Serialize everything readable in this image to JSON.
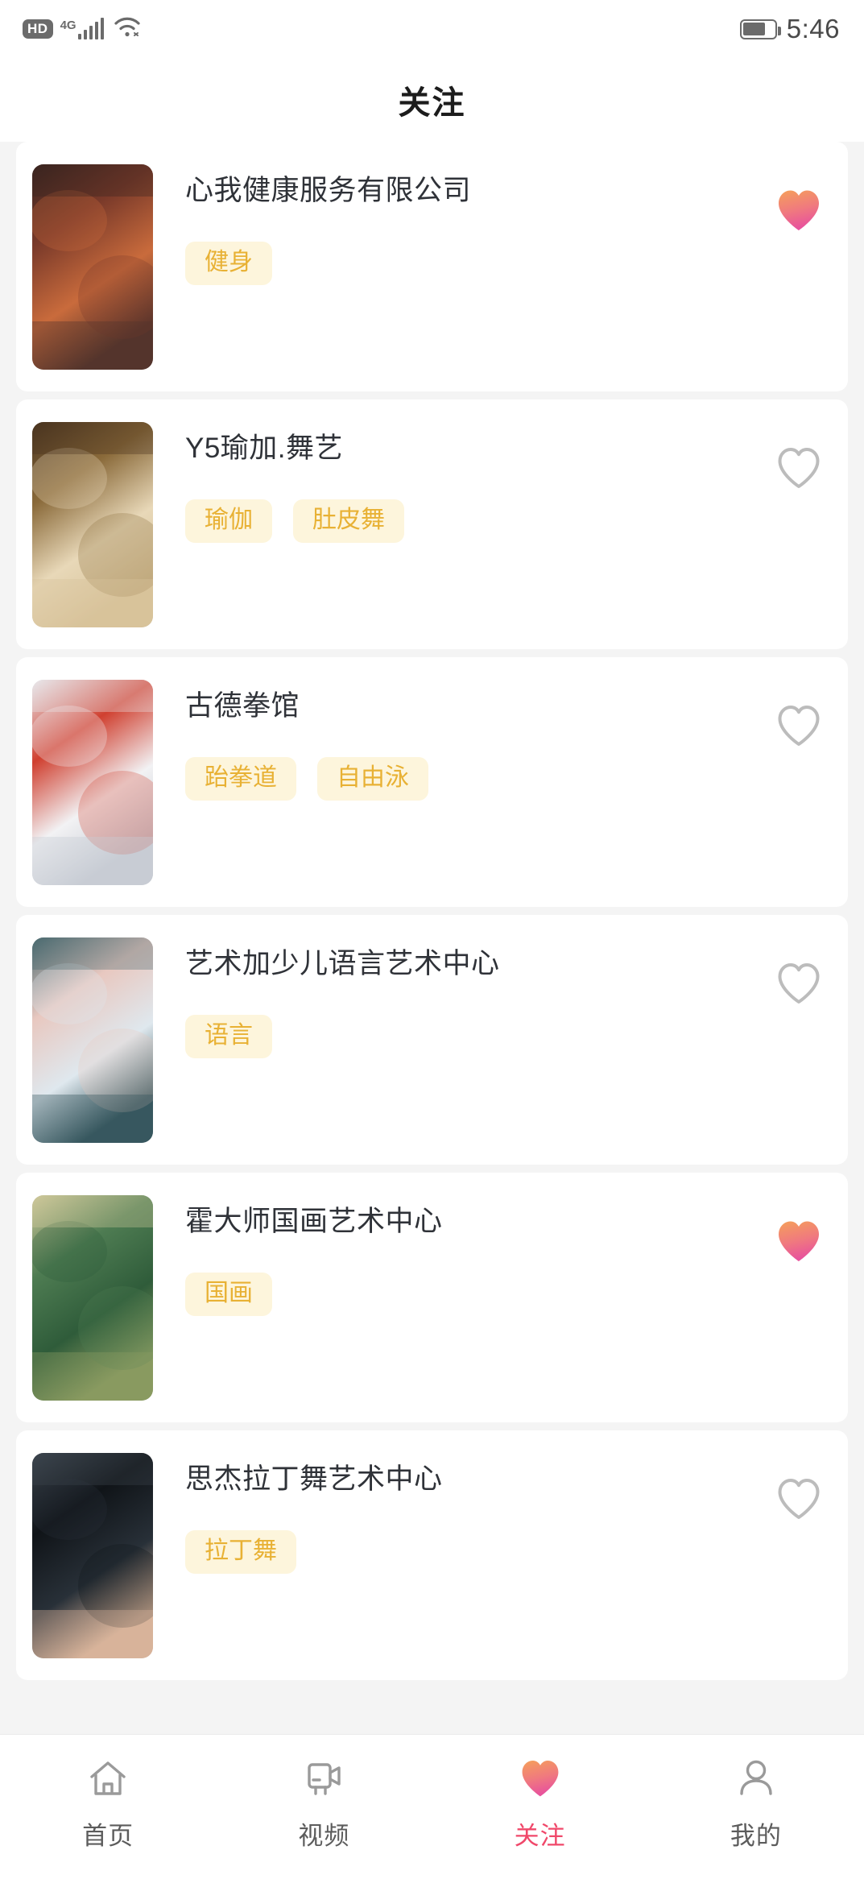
{
  "statusbar": {
    "hd_label": "HD",
    "network_label": "4G",
    "signal_icon": "signal-bars-icon",
    "wifi_icon": "wifi-icon",
    "battery_icon": "battery-icon",
    "battery_level_pct": 72,
    "time": "5:46"
  },
  "header": {
    "title": "关注"
  },
  "theme": {
    "page_bg": "#f4f4f4",
    "card_bg": "#ffffff",
    "tag_bg": "#fdf5dc",
    "tag_text": "#e8b134",
    "title_text": "#2f3238",
    "heart_filled_top": "#f5a05a",
    "heart_filled_bottom": "#e8539c",
    "heart_outline": "#bcbcbc",
    "active_tab_text": "#f0486a"
  },
  "list": {
    "items": [
      {
        "name": "心我健康服务有限公司",
        "tags": [
          "健身"
        ],
        "favorited": true,
        "thumb_alt": "gym-interior-photo",
        "thumb_colors": [
          "#3a2420",
          "#7a3a2a",
          "#c96b3c",
          "#55352c"
        ]
      },
      {
        "name": "Y5瑜加.舞艺",
        "tags": [
          "瑜伽",
          "肚皮舞"
        ],
        "favorited": false,
        "thumb_alt": "yoga-studio-storefront-photo",
        "thumb_colors": [
          "#4a3520",
          "#8a6a3a",
          "#e8d8b8",
          "#d8c39a"
        ]
      },
      {
        "name": "古德拳馆",
        "tags": [
          "跆拳道",
          "自由泳"
        ],
        "favorited": false,
        "thumb_alt": "boxing-gym-photo",
        "thumb_colors": [
          "#e8e8ec",
          "#d04030",
          "#f2f2f4",
          "#c8ccd4"
        ]
      },
      {
        "name": "艺术加少儿语言艺术中心",
        "tags": [
          "语言"
        ],
        "favorited": false,
        "thumb_alt": "childrens-art-center-photo",
        "thumb_colors": [
          "#4a6a70",
          "#e8c8c0",
          "#dfe8ee",
          "#37585f"
        ]
      },
      {
        "name": "霍大师国画艺术中心",
        "tags": [
          "国画"
        ],
        "favorited": true,
        "thumb_alt": "chinese-painting-photo",
        "thumb_colors": [
          "#cfc89a",
          "#4e7c52",
          "#2f5c3a",
          "#8a9a60"
        ]
      },
      {
        "name": "思杰拉丁舞艺术中心",
        "tags": [
          "拉丁舞"
        ],
        "favorited": false,
        "thumb_alt": "latin-dance-dress-photo",
        "thumb_colors": [
          "#3c454e",
          "#101418",
          "#283038",
          "#d8b49a"
        ]
      }
    ]
  },
  "tabbar": {
    "items": [
      {
        "label": "首页",
        "icon": "home-icon",
        "active": false
      },
      {
        "label": "视频",
        "icon": "video-camera-icon",
        "active": false
      },
      {
        "label": "关注",
        "icon": "heart-icon",
        "active": true
      },
      {
        "label": "我的",
        "icon": "person-icon",
        "active": false
      }
    ]
  }
}
